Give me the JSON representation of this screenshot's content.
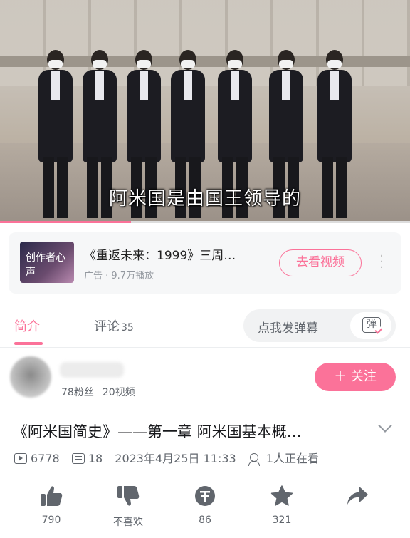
{
  "video": {
    "subtitle": "阿米国是由国王领导的",
    "progress_percent": 32
  },
  "ad": {
    "thumb_text": "创作者心声",
    "title": "《重返未来：1999》三周…",
    "meta": "广告 · 9.7万播放",
    "button": "去看视频",
    "more_icon": "more-vertical-icon"
  },
  "tabs": {
    "intro": "简介",
    "comments": "评论",
    "comments_count": "35",
    "danmaku_placeholder": "点我发弹幕",
    "danmaku_button": "弹"
  },
  "uploader": {
    "fans": "78粉丝",
    "videos": "20视频",
    "follow": "＋ 关注"
  },
  "video_info": {
    "title": "《阿米国简史》——第一章 阿米国基本概…",
    "plays": "6778",
    "danmaku_count": "18",
    "date": "2023年4月25日 11:33",
    "watching": "1人正在看"
  },
  "actions": {
    "like": "790",
    "dislike": "不喜欢",
    "coin": "86",
    "favorite": "321"
  },
  "colors": {
    "accent": "#fb7299",
    "text_secondary": "#61666d"
  }
}
